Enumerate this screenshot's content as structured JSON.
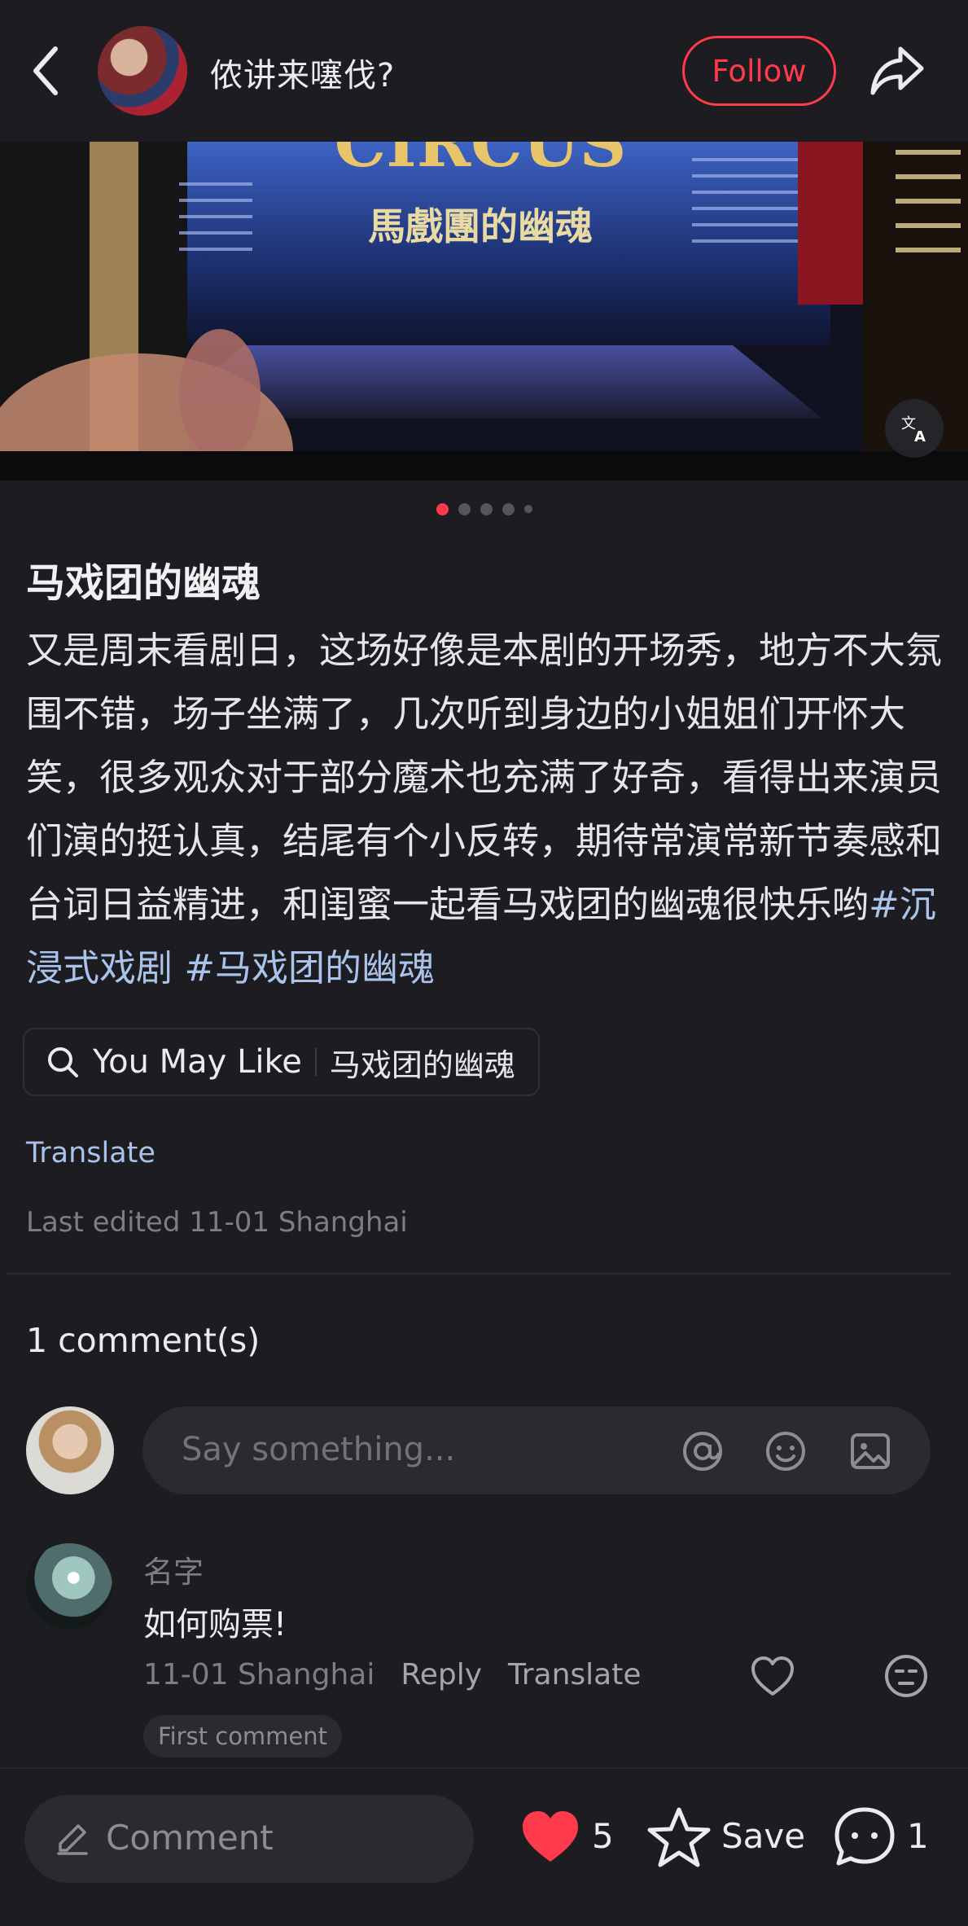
{
  "header": {
    "author_name": "侬讲来噻伐?",
    "follow_label": "Follow"
  },
  "carousel": {
    "image_text": "馬戲團的幽魂",
    "image_text_top": "CIRCUS",
    "total_slides": 5,
    "active_slide": 1
  },
  "post": {
    "title": "马戏团的幽魂",
    "body": "又是周末看剧日，这场好像是本剧的开场秀，地方不大氛围不错，场子坐满了，几次听到身边的小姐姐们开怀大笑，很多观众对于部分魔术也充满了好奇，看得出来演员们演的挺认真，结尾有个小反转，期待常演常新节奏感和台词日益精进，和闺蜜一起看马戏团的幽魂很快乐哟",
    "tags": [
      "#沉浸式戏剧",
      "#马戏团的幽魂"
    ],
    "you_may_like_label": "You May Like",
    "you_may_like_topic": "马戏团的幽魂",
    "translate_label": "Translate",
    "edited_text": "Last edited 11-01 Shanghai"
  },
  "comments": {
    "count_label": "1 comment(s)",
    "input_placeholder": "Say something...",
    "items": [
      {
        "name": "名字",
        "text": "如何购票!",
        "meta": "11-01 Shanghai",
        "reply_label": "Reply",
        "translate_label": "Translate",
        "badge": "First comment"
      }
    ]
  },
  "bottom_bar": {
    "comment_placeholder": "Comment",
    "like_count": "5",
    "save_label": "Save",
    "comment_count": "1"
  },
  "colors": {
    "background": "#1c1c21",
    "accent": "#ff3a4d",
    "link": "#a9c3ea"
  }
}
